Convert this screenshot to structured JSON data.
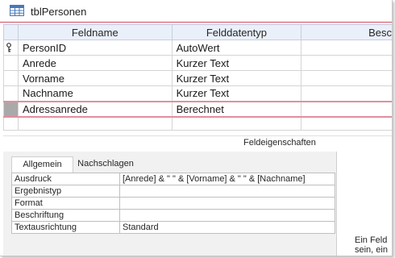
{
  "window": {
    "title": "tblPersonen",
    "icon": "table-icon",
    "accent_color": "#d24a64"
  },
  "design_grid": {
    "columns": [
      "Feldname",
      "Felddatentyp",
      "Besc"
    ],
    "rows": [
      {
        "field": "PersonID",
        "type": "AutoWert",
        "primary_key": true
      },
      {
        "field": "Anrede",
        "type": "Kurzer Text"
      },
      {
        "field": "Vorname",
        "type": "Kurzer Text"
      },
      {
        "field": "Nachname",
        "type": "Kurzer Text"
      },
      {
        "field": "Adressanrede",
        "type": "Berechnet",
        "selected": true
      },
      {
        "field": "",
        "type": ""
      }
    ]
  },
  "field_properties": {
    "section_title": "Feldeigenschaften",
    "tabs": [
      "Allgemein",
      "Nachschlagen"
    ],
    "active_tab": "Allgemein",
    "rows": [
      {
        "name": "Ausdruck",
        "value": "[Anrede] & \" \" & [Vorname] & \" \" & [Nachname]"
      },
      {
        "name": "Ergebnistyp",
        "value": ""
      },
      {
        "name": "Format",
        "value": ""
      },
      {
        "name": "Beschriftung",
        "value": ""
      },
      {
        "name": "Textausrichtung",
        "value": "Standard"
      }
    ],
    "hint_lines": [
      "Ein Feld",
      "sein, ein"
    ]
  }
}
